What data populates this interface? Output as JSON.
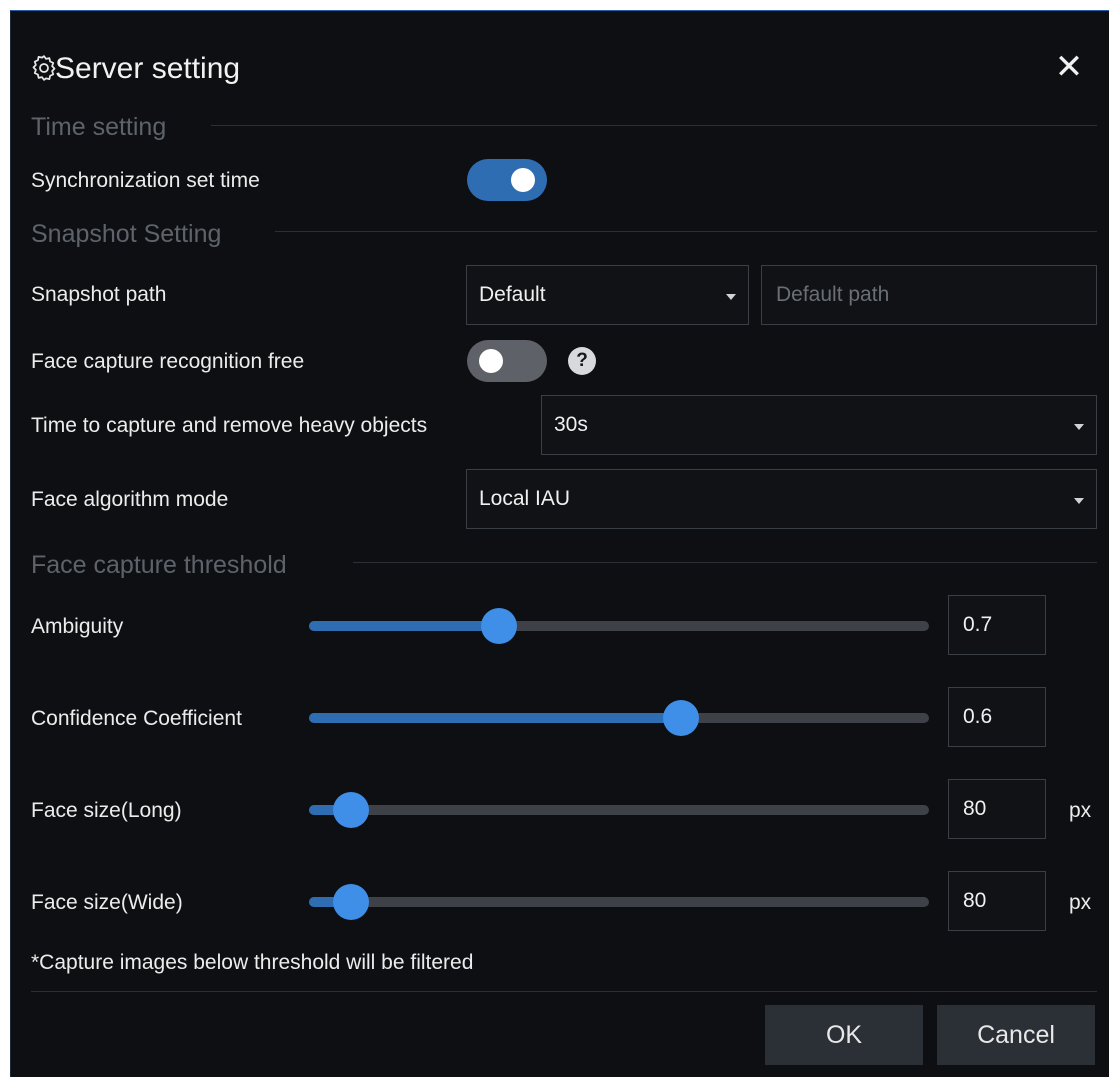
{
  "dialog": {
    "title": "Server setting",
    "close_label": "✕"
  },
  "time_section": {
    "heading": "Time setting",
    "sync_label": "Synchronization set time",
    "sync_enabled": true
  },
  "snapshot_section": {
    "heading": "Snapshot Setting",
    "path_label": "Snapshot path",
    "path_mode": "Default",
    "path_placeholder": "Default path",
    "recog_free_label": "Face capture recognition free",
    "recog_free_enabled": false,
    "help_glyph": "?",
    "remove_heavy_label": "Time to capture and remove heavy objects",
    "remove_heavy_value": "30s",
    "algo_label": "Face algorithm mode",
    "algo_value": "Local IAU"
  },
  "threshold_section": {
    "heading": "Face capture threshold",
    "sliders": [
      {
        "label": "Ambiguity",
        "value": "0.7",
        "unit": ""
      },
      {
        "label": "Confidence Coefficient",
        "value": "0.6",
        "unit": ""
      },
      {
        "label": "Face size(Long)",
        "value": "80",
        "unit": "px"
      },
      {
        "label": "Face size(Wide)",
        "value": "80",
        "unit": "px"
      }
    ],
    "note": "*Capture images below threshold will be filtered"
  },
  "footer": {
    "ok_label": "OK",
    "cancel_label": "Cancel"
  },
  "colors": {
    "accent": "#2f6db3",
    "thumb": "#3f8ee8",
    "background": "#0d0f12"
  },
  "icons": {
    "title_icon": "gear-icon",
    "close_icon": "close-icon",
    "help_icon": "help-icon"
  }
}
